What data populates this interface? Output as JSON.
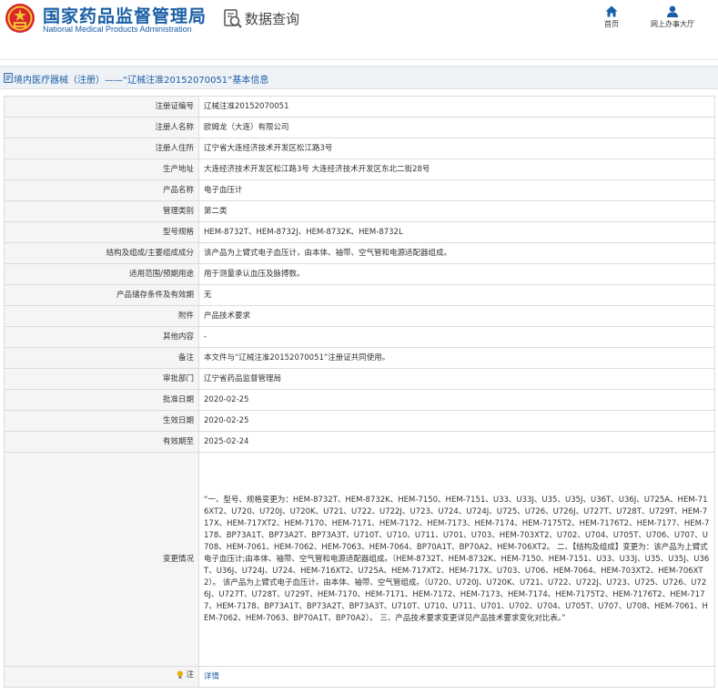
{
  "header": {
    "logo_cn": "国家药品监督管理局",
    "logo_en": "National Medical Products Administration",
    "emblem_icon": "national-emblem-icon",
    "search_title": "数据查询",
    "search_icon": "magnifier-document-icon",
    "nav": [
      {
        "label": "首页",
        "icon": "home-icon"
      },
      {
        "label": "网上办事大厅",
        "icon": "user-icon"
      }
    ]
  },
  "titlebar": {
    "text": "境内医疗器械（注册）——“辽械注准20152070051”基本信息",
    "icon": "document-icon"
  },
  "details": {
    "rows": [
      {
        "label": "注册证编号",
        "value": "辽械注准20152070051"
      },
      {
        "label": "注册人名称",
        "value": "欧姆龙（大连）有限公司"
      },
      {
        "label": "注册人住所",
        "value": "辽宁省大连经济技术开发区松江路3号"
      },
      {
        "label": "生产地址",
        "value": "大连经济技术开发区松江路3号 大连经济技术开发区东北二街28号"
      },
      {
        "label": "产品名称",
        "value": "电子血压计"
      },
      {
        "label": "管理类别",
        "value": "第二类"
      },
      {
        "label": "型号规格",
        "value": "HEM-8732T、HEM-8732J、HEM-8732K、HEM-8732L"
      },
      {
        "label": "结构及组成/主要组成成分",
        "value": "该产品为上臂式电子血压计，由本体、袖带、空气管和电源适配器组成。"
      },
      {
        "label": "适用范围/预期用途",
        "value": "用于测量承认血压及脉搏数。"
      },
      {
        "label": "产品储存条件及有效期",
        "value": "无"
      },
      {
        "label": "附件",
        "value": "产品技术要求"
      },
      {
        "label": "其他内容",
        "value": "-"
      },
      {
        "label": "备注",
        "value": "本文件与“辽械注准20152070051”注册证共同使用。"
      },
      {
        "label": "审批部门",
        "value": "辽宁省药品监督管理局"
      },
      {
        "label": "批准日期",
        "value": "2020-02-25"
      },
      {
        "label": "生效日期",
        "value": "2020-02-25"
      },
      {
        "label": "有效期至",
        "value": "2025-02-24"
      }
    ],
    "change_label": "变更情况",
    "change_value": "“一、型号、规格变更为：HEM-8732T、HEM-8732K、HEM-7150、HEM-7151、U33、U33J、U35、U35J、U36T、U36J、U725A、HEM-716XT2、U720、U720J、U720K、U721、U722、U722J、U723、U724、U724J、U725、U726、U726J、U727T、U728T、U729T、HEM-717X、HEM-717XT2、HEM-7170、HEM-7171、HEM-7172、HEM-7173、HEM-7174、HEM-7175T2、HEM-7176T2、HEM-7177、HEM-7178、BP73A1T、BP73A2T、BP73A3T、U710T、U710、U711、U701、U703、HEM-703XT2、U702、U704、U705T、U706、U707、U708、HEM-7061、HEM-7062、HEM-7063、HEM-7064、BP70A1T、BP70A2、HEM-706XT2。 二、【结构及组成】变更为：该产品为上臂式电子血压计;由本体、袖带、空气管和电源适配器组成。（HEM-8732T、HEM-8732K、HEM-7150、HEM-7151、U33、U33J、U35、U35J、U36T、U36J、U724J、U724、HEM-716XT2、U725A、HEM-717XT2、HEM-717X、U703、U706、HEM-7064、HEM-703XT2、HEM-706XT2）。 该产品为上臂式电子血压计。由本体、袖带、空气管组成。（U720、U720J、U720K、U721、U722、U722J、U723、U725、U726、U726J、U727T、U728T、U729T、HEM-7170、HEM-7171、HEM-7172、HEM-7173、HEM-7174、HEM-7175T2、HEM-7176T2、HEM-7177、HEM-7178、BP73A1T、BP73A2T、BP73A3T、U710T、U710、U711、U701、U702、U704、U705T、U707、U708、HEM-7061、HEM-7062、HEM-7063、BP70A1T、BP70A2）。 三、产品技术要求变更详见产品技术要求变化对比表。”",
    "note_label": "注",
    "note_icon": "lightbulb-icon",
    "note_link": "详情"
  }
}
